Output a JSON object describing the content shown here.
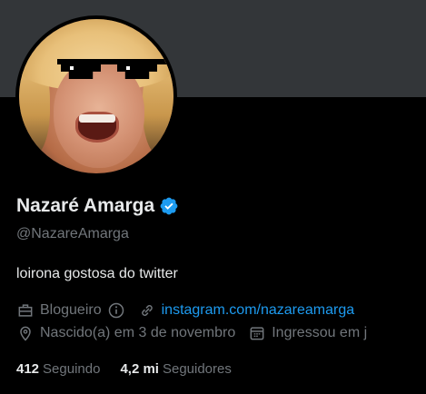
{
  "profile": {
    "name": "Nazaré Amarga",
    "handle": "@NazareAmarga",
    "bio": "loirona gostosa do twitter",
    "category": "Blogueiro",
    "website": "instagram.com/nazareamarga",
    "birthday": "Nascido(a) em 3 de novembro",
    "joined": "Ingressou em j",
    "following_count": "412",
    "following_label": "Seguindo",
    "followers_count": "4,2 mi",
    "followers_label": "Seguidores"
  },
  "colors": {
    "background": "#000000",
    "banner": "#333639",
    "text_primary": "#e7e9ea",
    "text_secondary": "#71767b",
    "link": "#1d9bf0",
    "verified": "#1d9bf0"
  },
  "icons": {
    "verified": "verified-badge-icon",
    "category": "briefcase-icon",
    "info": "info-icon",
    "website": "link-icon",
    "birthday": "location-pin-icon",
    "joined": "calendar-icon"
  }
}
